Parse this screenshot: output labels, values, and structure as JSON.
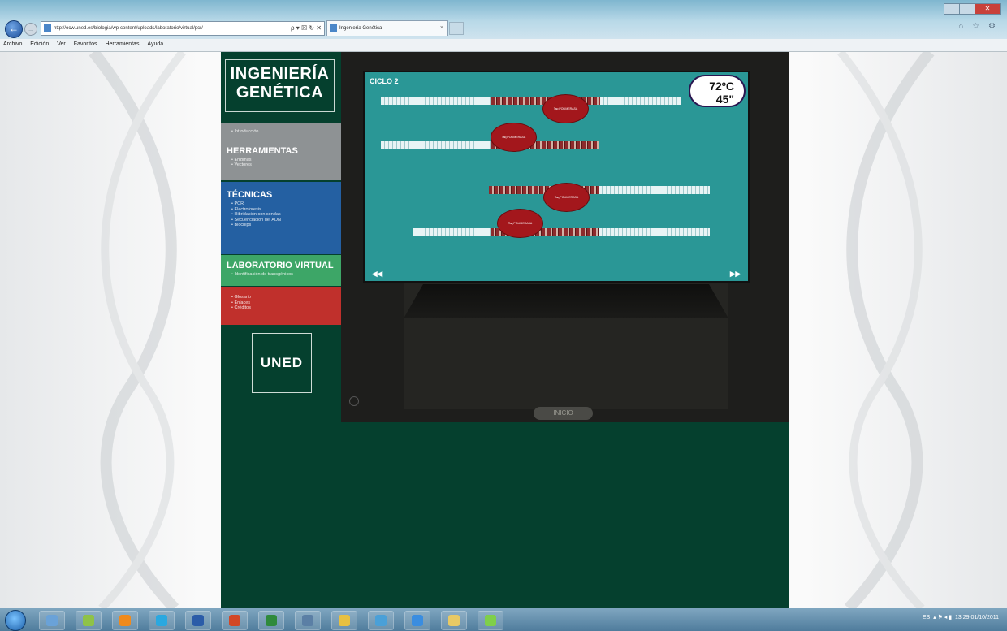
{
  "browser": {
    "address": "http://ocw.uned.es/biologia/wp-content/uploads/laboratorio/virtual/pcr/",
    "tab_title": "Ingeniería Genética",
    "tab_close": "×",
    "address_controls": "ρ ▾ ☒ ↻ ✕",
    "menu": [
      "Archivo",
      "Edición",
      "Ver",
      "Favoritos",
      "Herramientas",
      "Ayuda"
    ],
    "back_icon": "←",
    "forward_icon": "→",
    "nav_icons": "⌂ ☆ ⚙"
  },
  "site": {
    "logo_line1": "INGENIERÍA",
    "logo_line2": "GENÉTICA",
    "sections": {
      "intro": {
        "items": [
          "Introducción"
        ]
      },
      "herramientas": {
        "heading": "HERRAMIENTAS",
        "items": [
          "Enzimas",
          "Vectores"
        ]
      },
      "tecnicas": {
        "heading": "TÉCNICAS",
        "items": [
          "PCR",
          "Electroforesis",
          "Hibridación con sondas",
          "Secuenciación del ADN",
          "Biochips"
        ]
      },
      "laboratorio": {
        "heading": "LABORATORIO VIRTUAL",
        "items": [
          "Identificación de transgénicos"
        ]
      },
      "extra": {
        "items": [
          "Glosario",
          "Enlaces",
          "Créditos"
        ]
      }
    },
    "uned_logo": "UNED"
  },
  "animation": {
    "cycle_label": "CICLO 2",
    "temperature": "72ºC",
    "time": "45\"",
    "polymerase_label": "Taq POLIMERASA",
    "prev_arrow": "◂◂",
    "next_arrow": "▸▸",
    "inicio_button": "INICIO"
  },
  "taskbar": {
    "apps": [
      {
        "name": "explorer",
        "color": "#6aa2d8"
      },
      {
        "name": "android",
        "color": "#8fc248"
      },
      {
        "name": "vlc",
        "color": "#f08a1c"
      },
      {
        "name": "skype",
        "color": "#2aa8e0"
      },
      {
        "name": "word",
        "color": "#2b5ca8"
      },
      {
        "name": "powerpoint",
        "color": "#d24726"
      },
      {
        "name": "excel",
        "color": "#2f8a3c"
      },
      {
        "name": "tool",
        "color": "#5b7fa5"
      },
      {
        "name": "user",
        "color": "#e8c040"
      },
      {
        "name": "globe",
        "color": "#4aa0d8"
      },
      {
        "name": "internet-explorer",
        "color": "#3a8de0"
      },
      {
        "name": "folder",
        "color": "#e8c964"
      },
      {
        "name": "messenger",
        "color": "#7fcf4a"
      }
    ],
    "tray": {
      "lang": "ES",
      "time": "13:29",
      "date": "01/10/2011"
    }
  },
  "colors": {
    "site_bg": "#05402e",
    "screen_bg": "#2a9796",
    "intro_bg": "#8e9294",
    "tecnicas_bg": "#2460a2",
    "lab_bg": "#3da667",
    "extra_bg": "#c0302c",
    "polymerase": "#a3171c"
  }
}
